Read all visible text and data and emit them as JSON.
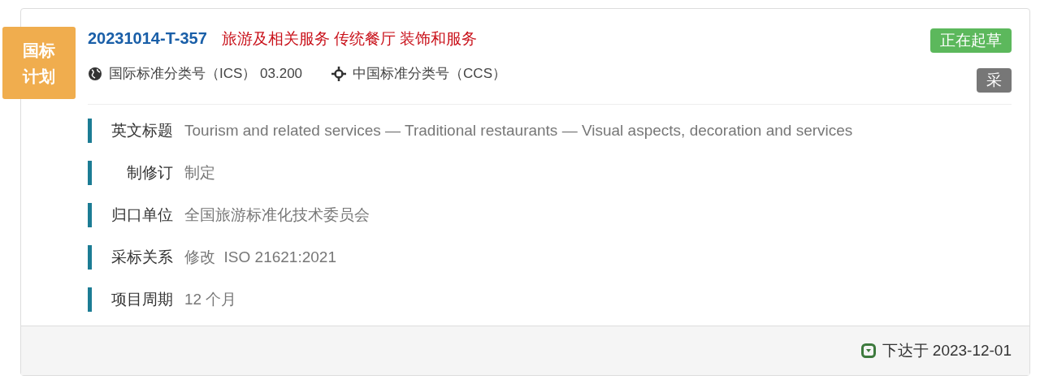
{
  "ribbon": {
    "label": "国标计划"
  },
  "header": {
    "code": "20231014-T-357",
    "title": "旅游及相关服务 传统餐厅 装饰和服务"
  },
  "classifications": [
    {
      "kind": "globe",
      "label": "国际标准分类号（ICS）",
      "value": "03.200"
    },
    {
      "kind": "crosshair",
      "label": "中国标准分类号（CCS）"
    }
  ],
  "badges": [
    {
      "label": "正在起草",
      "color": "#5cb85c"
    },
    {
      "label": "采",
      "color": "#777777"
    }
  ],
  "details": [
    {
      "label": "英文标题",
      "value": "Tourism and related services — Traditional restaurants — Visual aspects, decoration and services"
    },
    {
      "label": "制修订",
      "value": "制定"
    },
    {
      "label": "归口单位",
      "value": "全国旅游标准化技术委员会"
    },
    {
      "label": "采标关系",
      "value": "修改  ISO 21621:2021"
    },
    {
      "label": "项目周期",
      "value": "12 个月"
    }
  ],
  "footer": {
    "text": "下达于 2023-12-01"
  }
}
